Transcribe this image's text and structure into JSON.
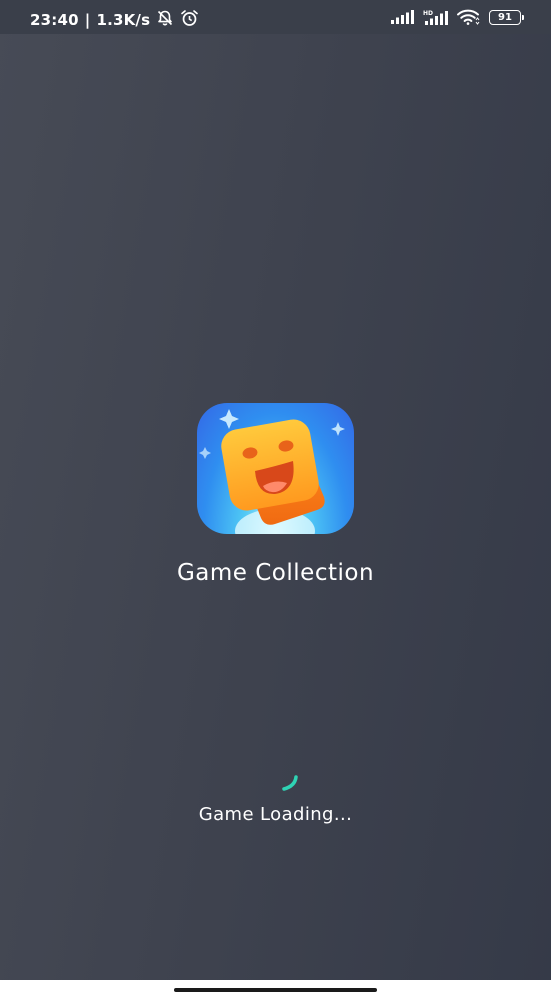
{
  "status_bar": {
    "time": "23:40",
    "separator": "|",
    "net_speed": "1.3K/s",
    "icons": [
      "bell-muted-icon",
      "alarm-clock-icon",
      "signal-icon",
      "hd-signal-icon",
      "wifi-icon",
      "battery-icon"
    ],
    "battery_level": "91"
  },
  "app": {
    "name": "Game Collection",
    "loading_text": "Game Loading...",
    "icon": "smiley-cube-icon"
  },
  "colors": {
    "background": "#3f434f",
    "spinner": "#2fd3b4",
    "text": "#ffffff"
  }
}
